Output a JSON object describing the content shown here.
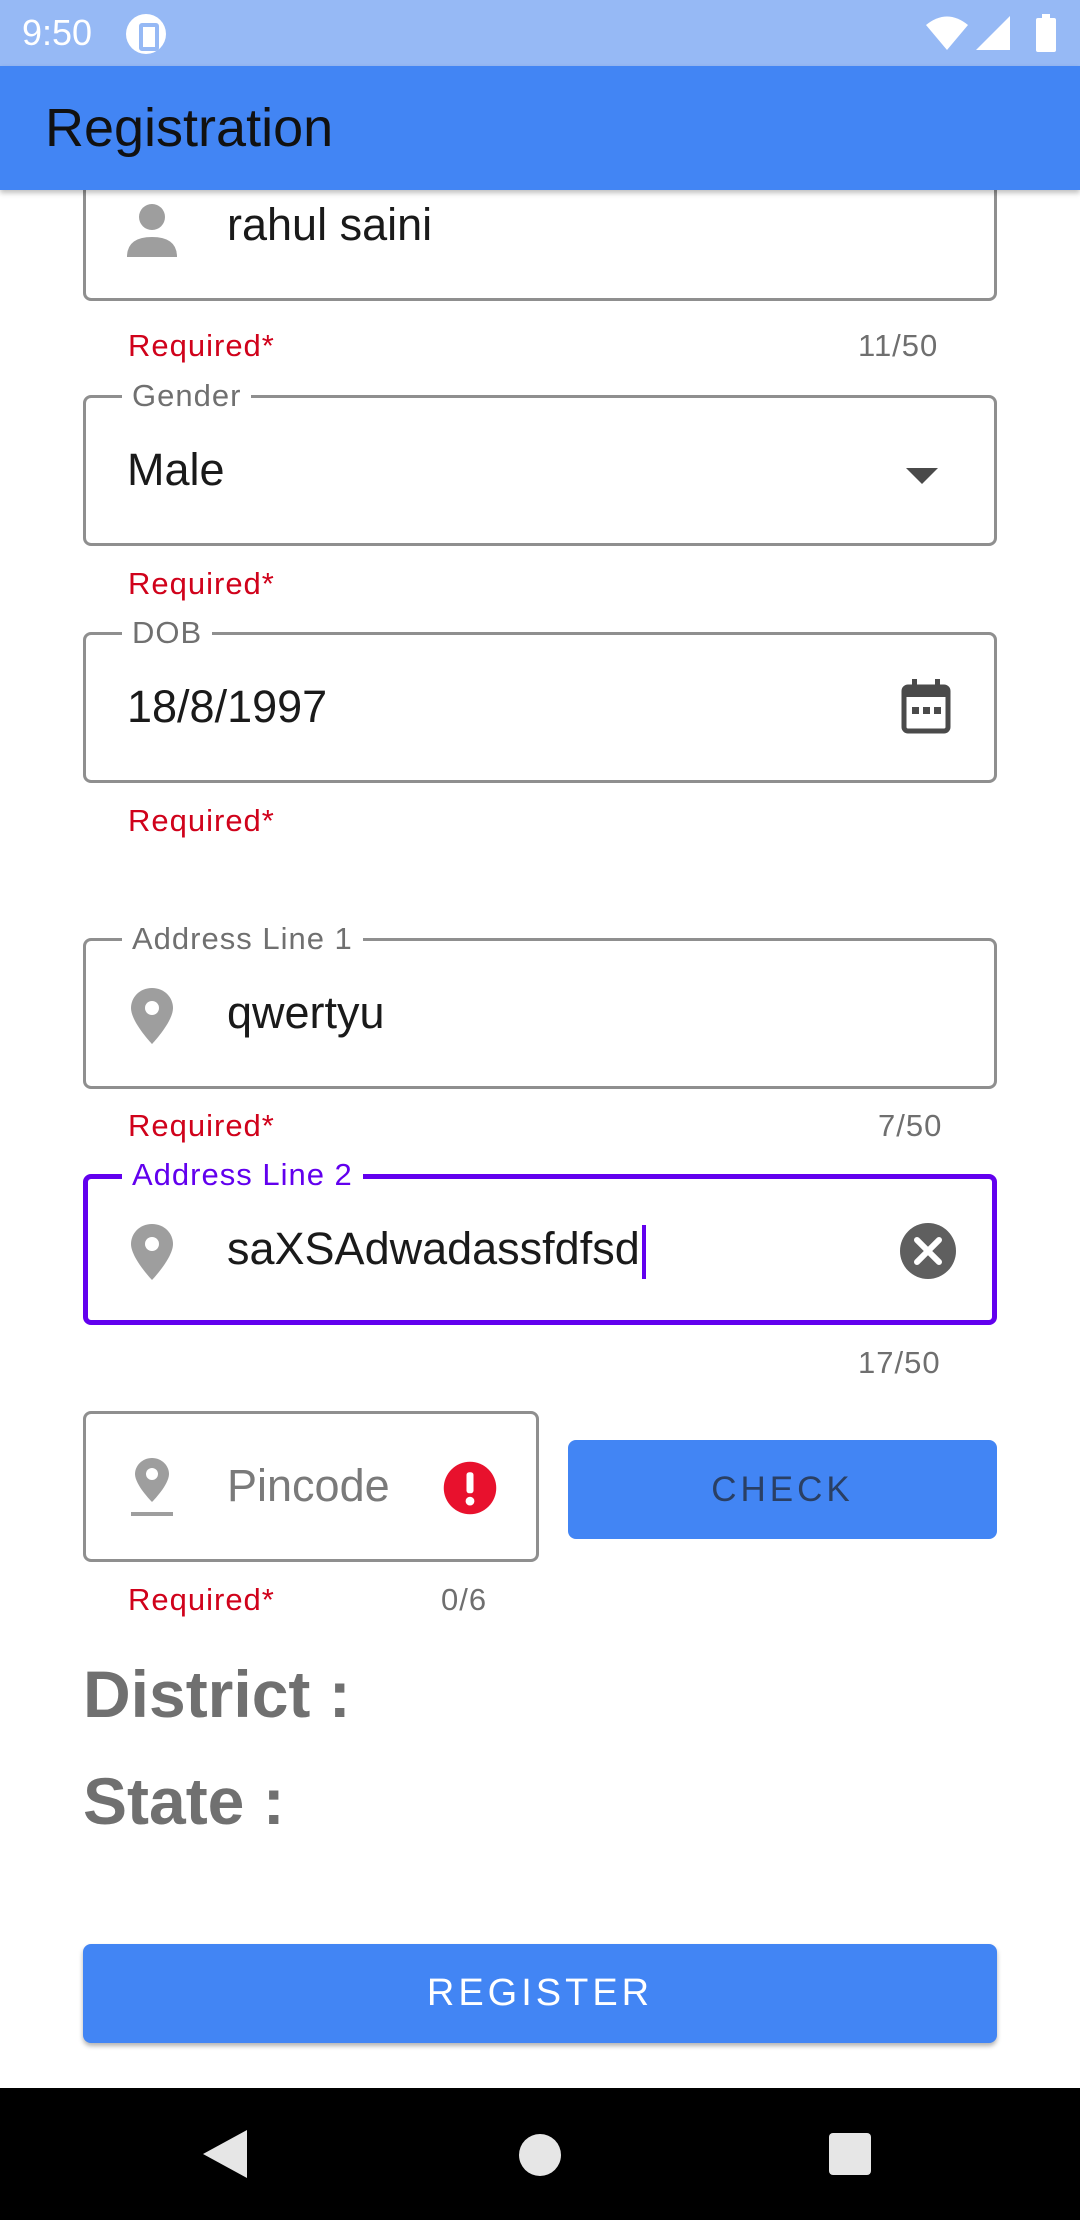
{
  "status_bar": {
    "time": "9:50"
  },
  "app_bar": {
    "title": "Registration"
  },
  "form": {
    "name": {
      "value": "rahul saini",
      "helper": "Required*",
      "counter": "11/50"
    },
    "gender": {
      "label": "Gender",
      "value": "Male",
      "helper": "Required*"
    },
    "dob": {
      "label": "DOB",
      "value": "18/8/1997",
      "helper": "Required*"
    },
    "address1": {
      "label": "Address Line 1",
      "value": "qwertyu",
      "helper": "Required*",
      "counter": "7/50"
    },
    "address2": {
      "label": "Address Line 2",
      "value": "saXSAdwadassfdfsd",
      "counter": "17/50"
    },
    "pincode": {
      "placeholder": "Pincode",
      "helper": "Required*",
      "counter": "0/6"
    },
    "check_label": "CHECK",
    "district_label": "District :",
    "state_label": "State :",
    "register_label": "REGISTER"
  },
  "colors": {
    "primary": "#4285f4",
    "status_bar": "#96b9f5",
    "focus": "#6200ee",
    "error": "#d0021b"
  },
  "icons": [
    "wifi-icon",
    "signal-icon",
    "battery-icon",
    "person-icon",
    "dropdown-arrow-icon",
    "calendar-icon",
    "location-pin-icon",
    "clear-icon",
    "error-icon"
  ]
}
